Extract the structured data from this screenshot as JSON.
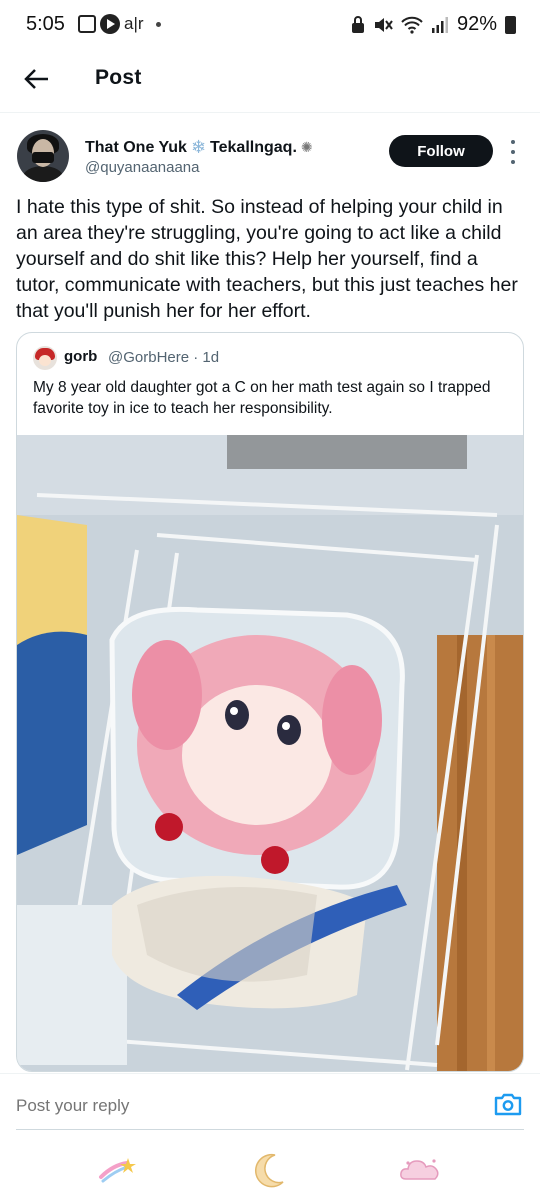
{
  "status_bar": {
    "time": "5:05",
    "carrier_glyph": "a|r",
    "battery": "92%"
  },
  "header": {
    "title": "Post",
    "back_icon": "arrow-left-icon"
  },
  "post": {
    "display_name": "That One Yuk",
    "display_name_suffix": "Tekallngaq.",
    "handle": "@quyanaanaana",
    "follow_label": "Follow",
    "text": "I hate this type of shit. So instead of helping your child in an area they're struggling, you're going to act like a child yourself and do shit like this? Help her yourself, find a tutor, communicate with teachers, but this just teaches her that you'll punish her for her effort."
  },
  "quote": {
    "display_name": "gorb",
    "handle_time": "@GorbHere · 1d",
    "text": "My 8 year old daughter got a C on her math test again so I trapped favorite toy in ice to teach her responsibility."
  },
  "reply": {
    "placeholder": "Post your reply"
  },
  "bottom_nav": {
    "items": [
      "shooting-star-icon",
      "moon-icon",
      "cloud-icon"
    ]
  },
  "colors": {
    "accent": "#1d9bf0",
    "text": "#0f1419",
    "secondary": "#536471",
    "follow_bg": "#0f1419"
  }
}
